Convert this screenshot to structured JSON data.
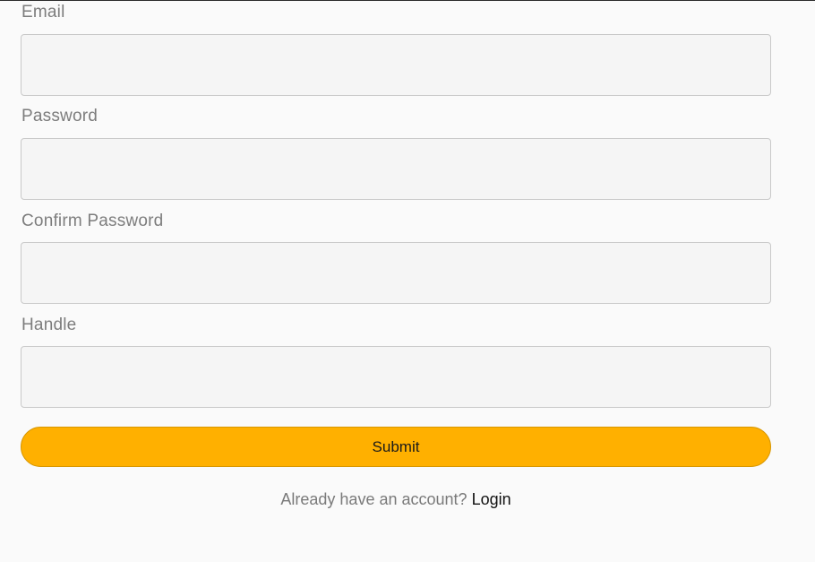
{
  "form": {
    "fields": [
      {
        "label": "Email",
        "value": "",
        "placeholder": ""
      },
      {
        "label": "Password",
        "value": "",
        "placeholder": ""
      },
      {
        "label": "Confirm Password",
        "value": "",
        "placeholder": ""
      },
      {
        "label": "Handle",
        "value": "",
        "placeholder": ""
      }
    ],
    "submit_label": "Submit"
  },
  "footer": {
    "prompt": "Already have an account?",
    "login_label": "Login"
  },
  "colors": {
    "accent": "#ffb000",
    "background": "#fafafa",
    "input_background": "#f5f5f5",
    "label": "#7d7d7d"
  }
}
